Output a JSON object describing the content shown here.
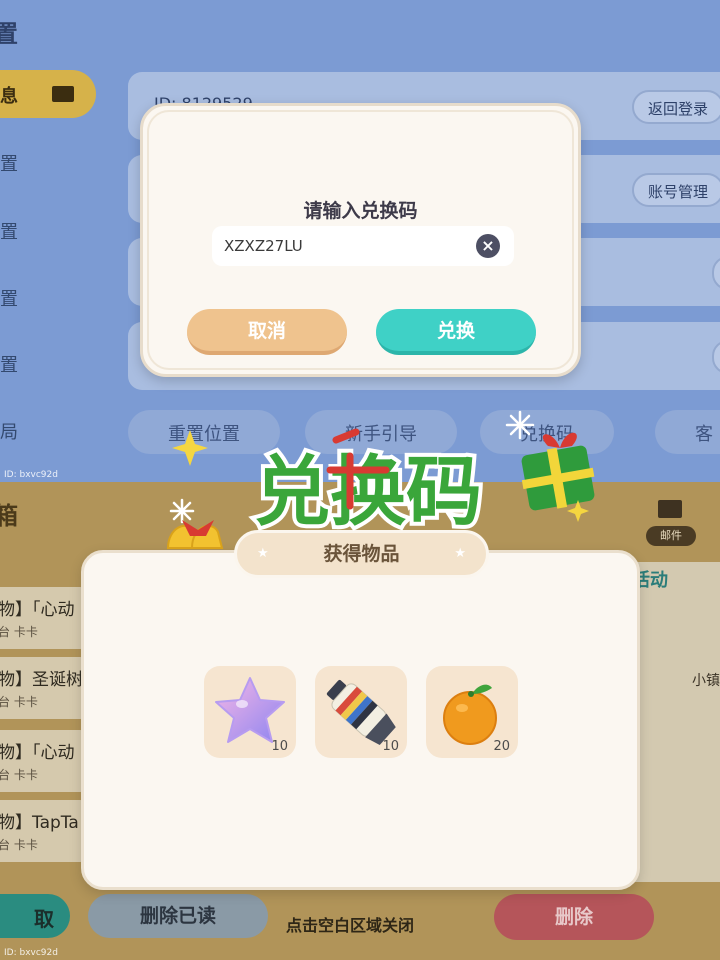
{
  "background_settings": {
    "title": "置",
    "sidebar": [
      {
        "label": "息",
        "active": true
      },
      {
        "label": "置"
      },
      {
        "label": "置"
      },
      {
        "label": "置"
      },
      {
        "label": "置"
      },
      {
        "label": "局"
      }
    ],
    "row_label": "ID: 8129529",
    "buttons": {
      "back_login": "返回登录",
      "account_manage": "账号管理"
    },
    "bottom_pills": [
      "重置位置",
      "新手引导",
      "兑换码",
      "客"
    ],
    "id_tag": "ID: bxvc92d"
  },
  "background_mail": {
    "title": "箱",
    "mail_items": [
      {
        "title": "物】「心动",
        "sub": "台 卡卡"
      },
      {
        "title": "物】圣诞树",
        "sub": "台 卡卡"
      },
      {
        "title": "物】「心动",
        "sub": "台 卡卡"
      },
      {
        "title": "物】TapTa",
        "sub": "台 卡卡"
      }
    ],
    "right_tab": "活动",
    "right_name": "小镇",
    "mail_badge": "邮件",
    "buttons": {
      "receive": "取",
      "delete_read": "删除已读",
      "delete": "删除"
    },
    "hint": "点击空白区域关闭",
    "id_tag": "ID: bxvc92d"
  },
  "redeem_dialog": {
    "prompt": "请输入兑换码",
    "code_value": "XZXZ27LU",
    "clear_icon": "clear-circle-icon",
    "cancel_label": "取消",
    "confirm_label": "兑换"
  },
  "banner": {
    "text": "兑换码",
    "colors": {
      "green": "#3aa63a",
      "red": "#d83a32",
      "outline": "#ffffff"
    }
  },
  "reward": {
    "tab_label": "获得物品",
    "items": [
      {
        "icon": "purple-star-icon",
        "qty": "10"
      },
      {
        "icon": "paint-tube-icon",
        "qty": "10"
      },
      {
        "icon": "orange-fruit-icon",
        "qty": "20"
      }
    ]
  }
}
